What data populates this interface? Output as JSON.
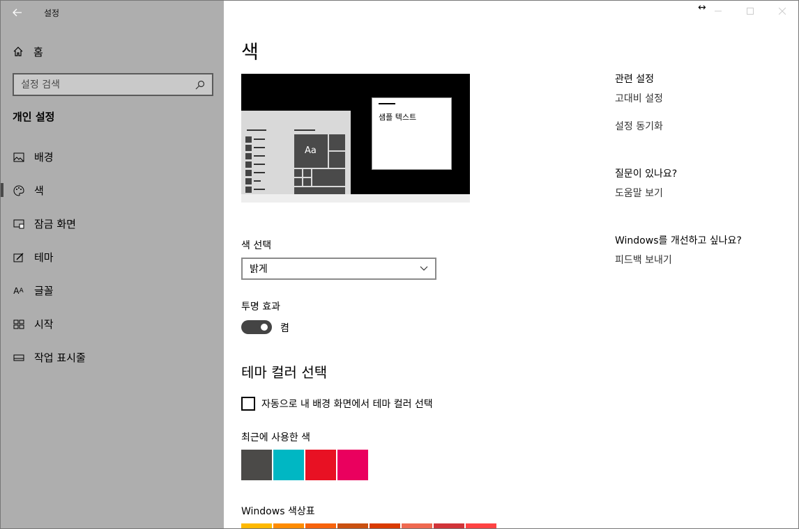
{
  "app": {
    "title": "설정"
  },
  "sidebar": {
    "home_label": "홈",
    "search_placeholder": "설정 검색",
    "section_title": "개인 설정",
    "items": [
      {
        "label": "배경",
        "icon": "picture-icon"
      },
      {
        "label": "색",
        "icon": "palette-icon",
        "active": true
      },
      {
        "label": "잠금 화면",
        "icon": "lock-screen-icon"
      },
      {
        "label": "테마",
        "icon": "theme-brush-icon"
      },
      {
        "label": "글꼴",
        "icon": "font-icon"
      },
      {
        "label": "시작",
        "icon": "start-grid-icon"
      },
      {
        "label": "작업 표시줄",
        "icon": "taskbar-icon"
      }
    ]
  },
  "main": {
    "title": "색",
    "preview": {
      "sample_text": "샘플 텍스트",
      "tile_text": "Aa"
    },
    "color_select": {
      "label": "색 선택",
      "value": "밝게"
    },
    "transparency": {
      "label": "투명 효과",
      "state": "켬",
      "on": true
    },
    "theme_color": {
      "title": "테마 컬러 선택",
      "auto_label": "자동으로 내 배경 화면에서 테마 컬러 선택",
      "auto_checked": false
    },
    "recent": {
      "label": "최근에 사용한 색",
      "colors": [
        "#4b4a48",
        "#00b7c3",
        "#e81123",
        "#ea005e"
      ]
    },
    "palette": {
      "label": "Windows 색상표",
      "colors": [
        "#ffb900",
        "#ff8c00",
        "#f7630c",
        "#ca5010",
        "#da3b01",
        "#ef6950",
        "#d13438",
        "#ff4343"
      ]
    }
  },
  "related": {
    "heading1": "관련 설정",
    "link1": "고대비 설정",
    "link2": "설정 동기화",
    "heading2": "질문이 있나요?",
    "link3": "도움말 보기",
    "heading3": "Windows를 개선하고 싶나요?",
    "link4": "피드백 보내기"
  }
}
